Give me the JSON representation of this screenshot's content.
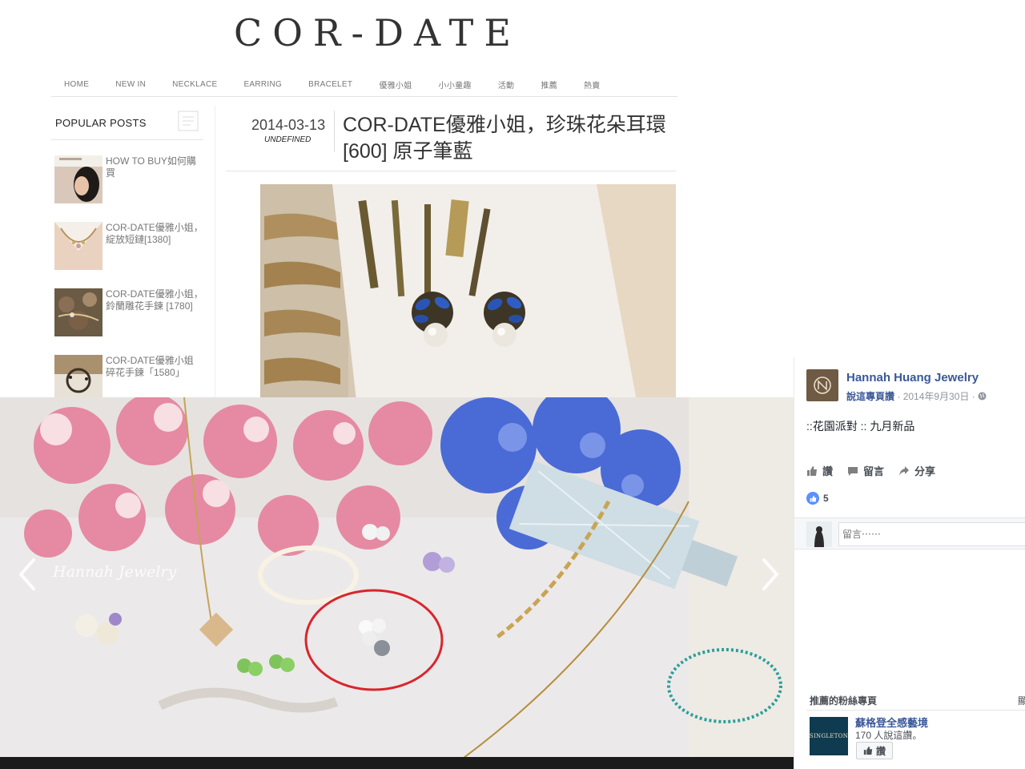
{
  "blog": {
    "logo": "COR-DATE",
    "nav": [
      "HOME",
      "NEW IN",
      "NECKLACE",
      "EARRING",
      "BRACELET",
      "優雅小姐",
      "小小童趣",
      "活動",
      "推薦",
      "熱賣"
    ],
    "popular_title": "POPULAR POSTS",
    "popular_posts": [
      {
        "title": "HOW TO BUY如何購買"
      },
      {
        "title": "COR-DATE優雅小姐，綻放短鏈[1380]"
      },
      {
        "title": "COR-DATE優雅小姐，鈴蘭雕花手鍊 [1780]"
      },
      {
        "title": "COR-DATE優雅小姐 碎花手鍊「1580」"
      }
    ],
    "post": {
      "date": "2014-03-13",
      "author": "UNDEFINED",
      "title": "COR-DATE優雅小姐，珍珠花朵耳環 [600] 原子筆藍"
    }
  },
  "slideshow": {
    "watermark": "Hannah Jewelry"
  },
  "facebook": {
    "page_name": "Hannah Huang Jewelry",
    "meta_link": "說這專頁讚",
    "meta_date": "· 2014年9月30日 ·",
    "post_text": "::花園派對 :: 九月新品",
    "actions": {
      "like": "讚",
      "comment": "留言",
      "share": "分享"
    },
    "like_count": "5",
    "comment_placeholder": "留言⋯⋯",
    "recommended_title": "推薦的粉絲專頁",
    "recommended_edge": "顯",
    "recommended": {
      "name": "蘇格登全感藝境",
      "count": "170 人說這讚。",
      "button": "讚",
      "logo_text": "SINGLETON"
    },
    "accent": "#3b5998"
  }
}
